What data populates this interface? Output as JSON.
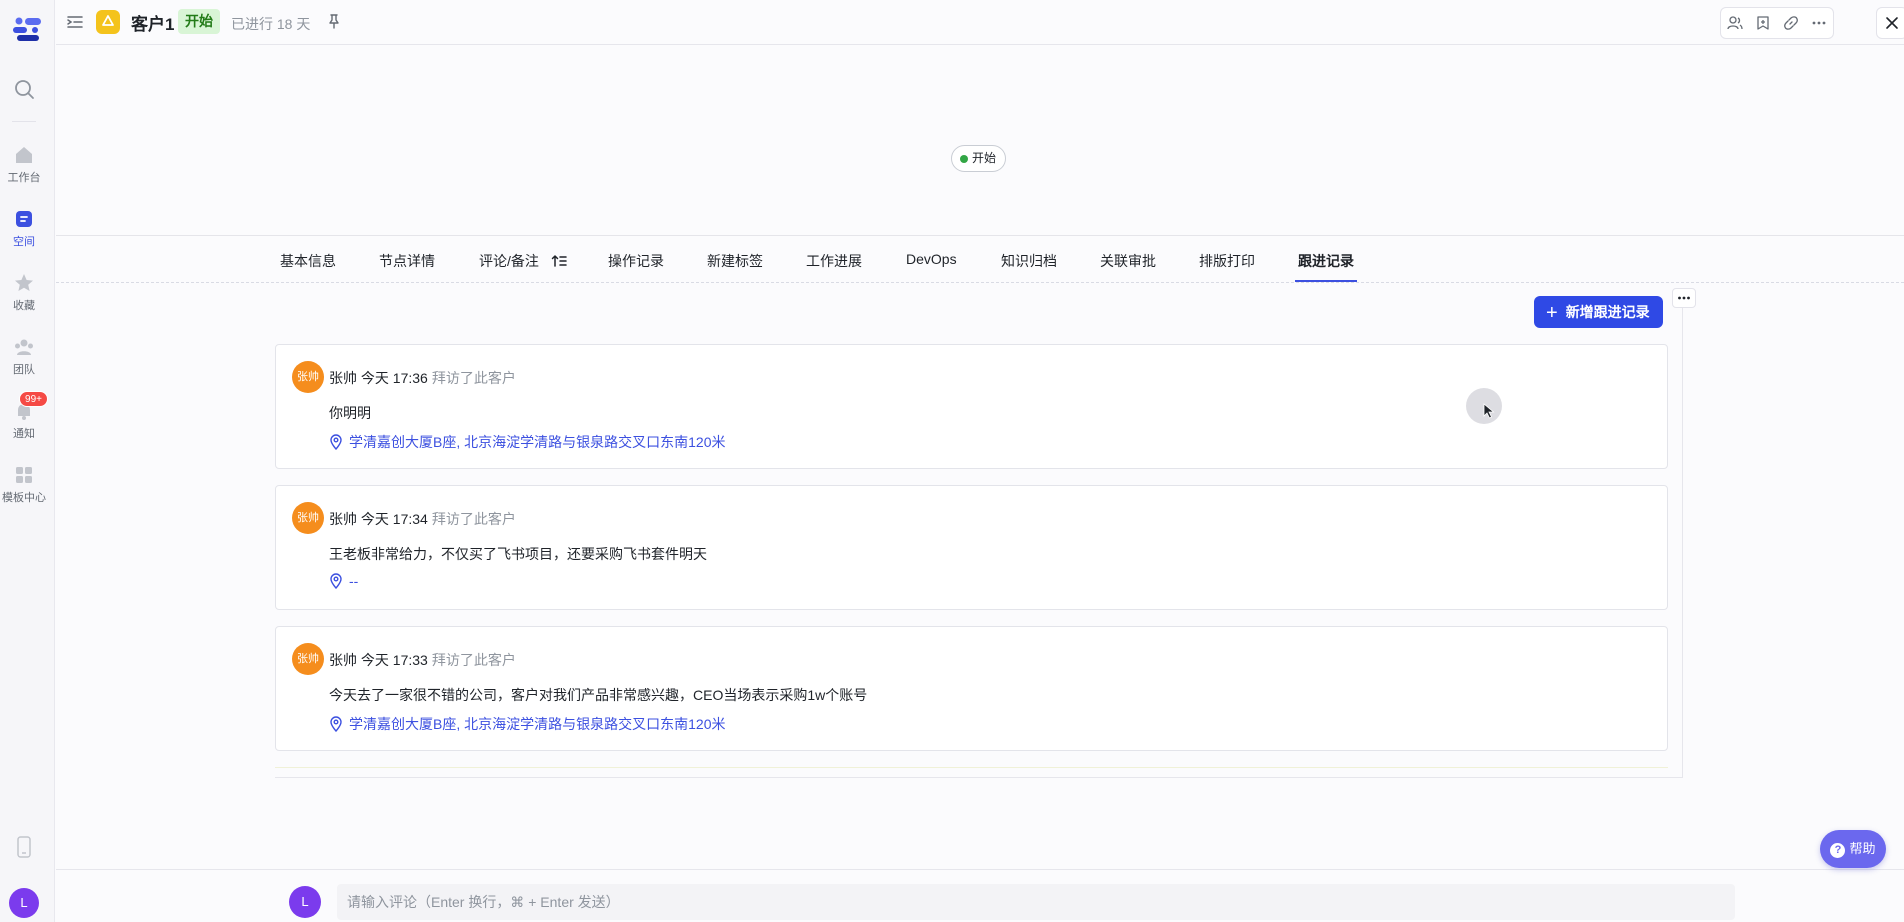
{
  "rail": {
    "items": [
      {
        "label": "工作台",
        "icon": "home-icon"
      },
      {
        "label": "空间",
        "icon": "space-icon"
      },
      {
        "label": "收藏",
        "icon": "star-icon"
      },
      {
        "label": "团队",
        "icon": "team-icon"
      },
      {
        "label": "通知",
        "icon": "bell-icon"
      },
      {
        "label": "模板中心",
        "icon": "template-icon"
      }
    ],
    "notification_badge": "99+",
    "user_initial": "L"
  },
  "header": {
    "title": "客户1",
    "status": "开始",
    "elapsed": "已进行 18 天"
  },
  "flow": {
    "node_label": "开始"
  },
  "tabs": [
    {
      "label": "基本信息"
    },
    {
      "label": "节点详情"
    },
    {
      "label": "评论/备注"
    },
    {
      "label": "操作记录"
    },
    {
      "label": "新建标签"
    },
    {
      "label": "工作进展"
    },
    {
      "label": "DevOps"
    },
    {
      "label": "知识归档"
    },
    {
      "label": "关联审批"
    },
    {
      "label": "排版打印"
    },
    {
      "label": "跟进记录"
    }
  ],
  "active_tab": "跟进记录",
  "add_button_label": "新增跟进记录",
  "records": [
    {
      "avatar": "张帅",
      "user": "张帅",
      "time": "今天 17:36",
      "action": "拜访了此客户",
      "text": "你明明",
      "location": "学清嘉创大厦B座, 北京海淀学清路与银泉路交叉口东南120米"
    },
    {
      "avatar": "张帅",
      "user": "张帅",
      "time": "今天 17:34",
      "action": "拜访了此客户",
      "text": "王老板非常给力，不仅买了飞书项目，还要采购飞书套件明天",
      "location": "--"
    },
    {
      "avatar": "张帅",
      "user": "张帅",
      "time": "今天 17:33",
      "action": "拜访了此客户",
      "text": "今天去了一家很不错的公司，客户对我们产品非常感兴趣，CEO当场表示采购1w个账号",
      "location": "学清嘉创大厦B座, 北京海淀学清路与银泉路交叉口东南120米"
    }
  ],
  "comment": {
    "avatar": "L",
    "placeholder": "请输入评论（Enter 换行，⌘ + Enter 发送）"
  },
  "help_label": "帮助",
  "colors": {
    "accent": "#2f49e5",
    "status_green": "#237b18",
    "avatar_orange": "#f58d1d",
    "avatar_purple": "#7b3bed"
  }
}
